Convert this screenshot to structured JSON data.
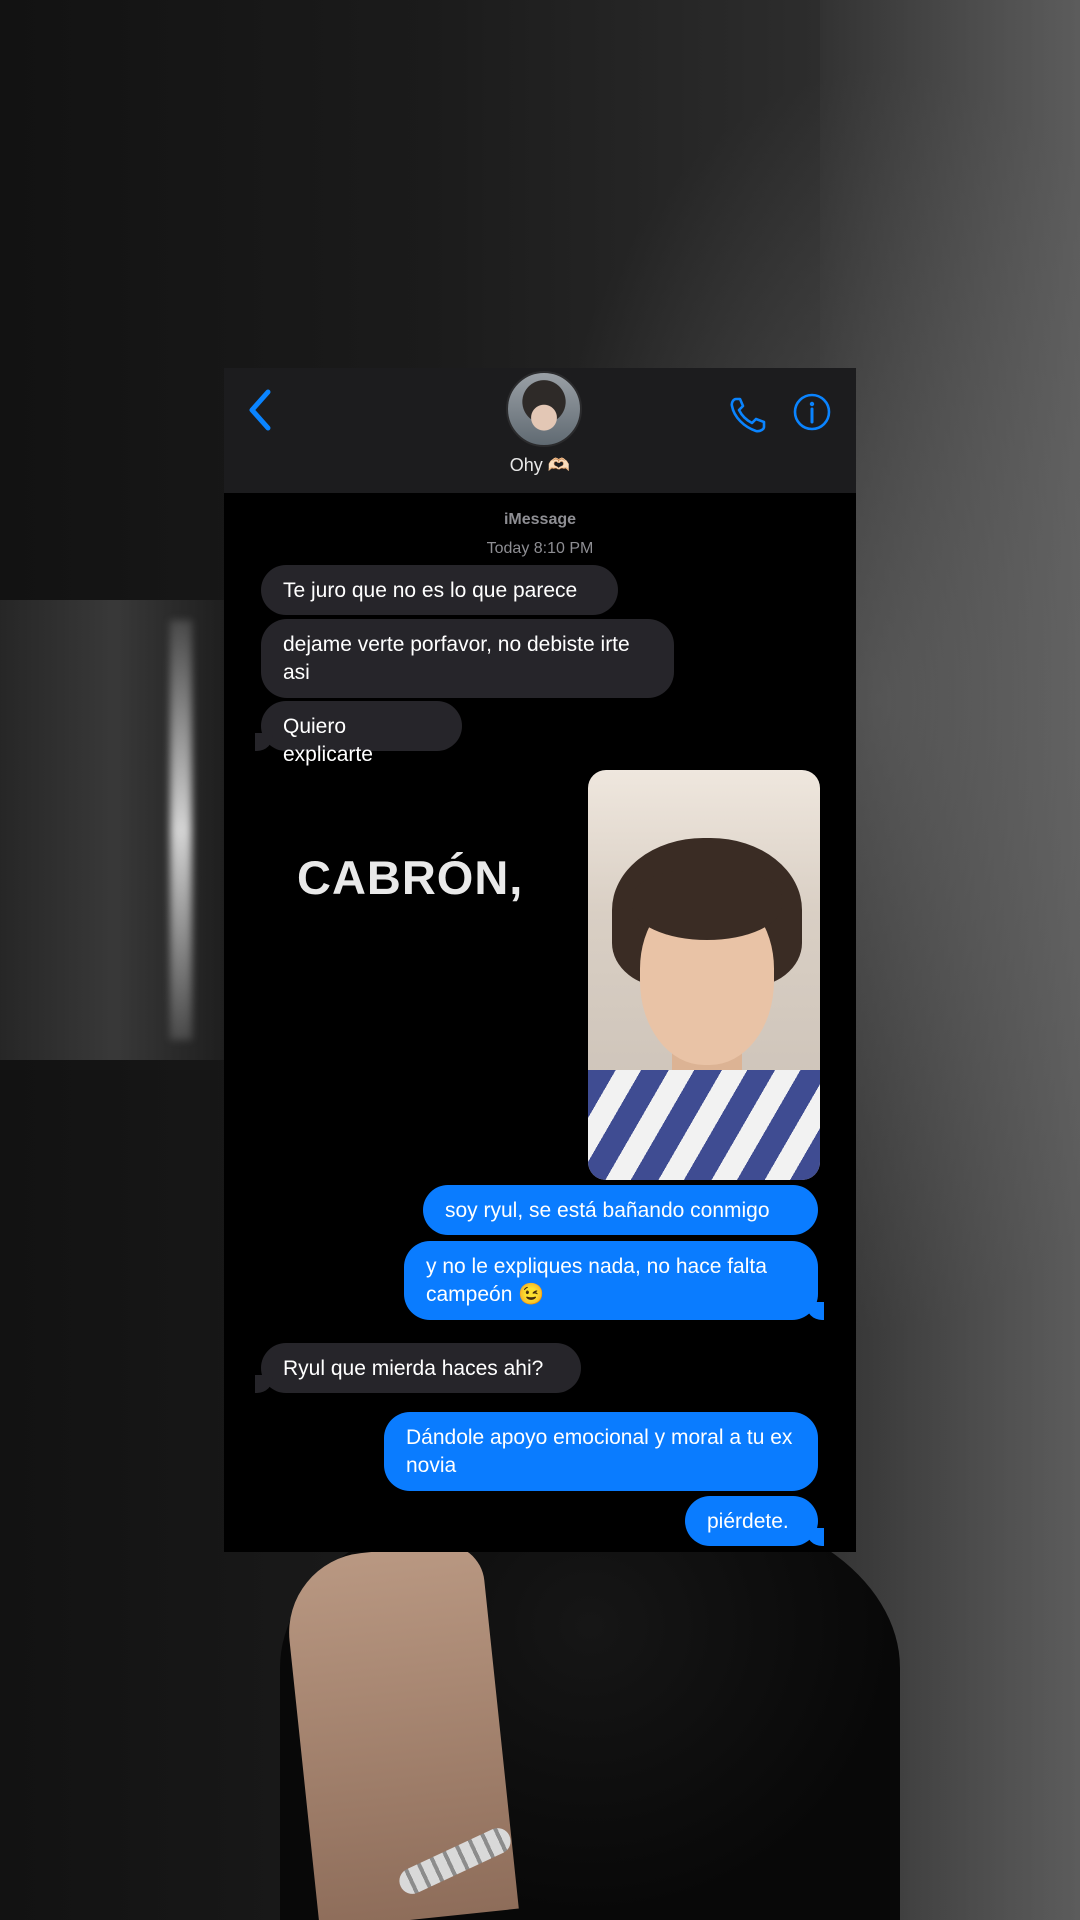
{
  "header": {
    "contact_name": "Ohy 🫶🏻",
    "back_icon": "chevron-left-icon",
    "call_icon": "phone-icon",
    "info_icon": "info-icon"
  },
  "thread": {
    "service": "iMessage",
    "timestamp": "Today 8:10 PM"
  },
  "messages": [
    {
      "from": "them",
      "text": "Te juro que no es lo que parece"
    },
    {
      "from": "them",
      "text": "dejame verte porfavor, no debiste irte asi"
    },
    {
      "from": "them",
      "text": "Quiero explicarte"
    },
    {
      "from": "me",
      "type": "image"
    },
    {
      "from": "me",
      "text": "soy ryul, se está bañando conmigo"
    },
    {
      "from": "me",
      "text": "y no le expliques nada, no hace falta campeón 😉"
    },
    {
      "from": "them",
      "text": "Ryul que mierda haces ahi?"
    },
    {
      "from": "me",
      "text": "Dándole apoyo emocional y moral a tu ex novia"
    },
    {
      "from": "me",
      "text": "piérdete."
    }
  ],
  "overlay": {
    "caption": "CABRÓN,"
  },
  "colors": {
    "accent": "#0a84ff",
    "outgoing_bubble": "#0a7cff",
    "incoming_bubble": "#26252a",
    "header_bg": "#1c1c1e"
  }
}
